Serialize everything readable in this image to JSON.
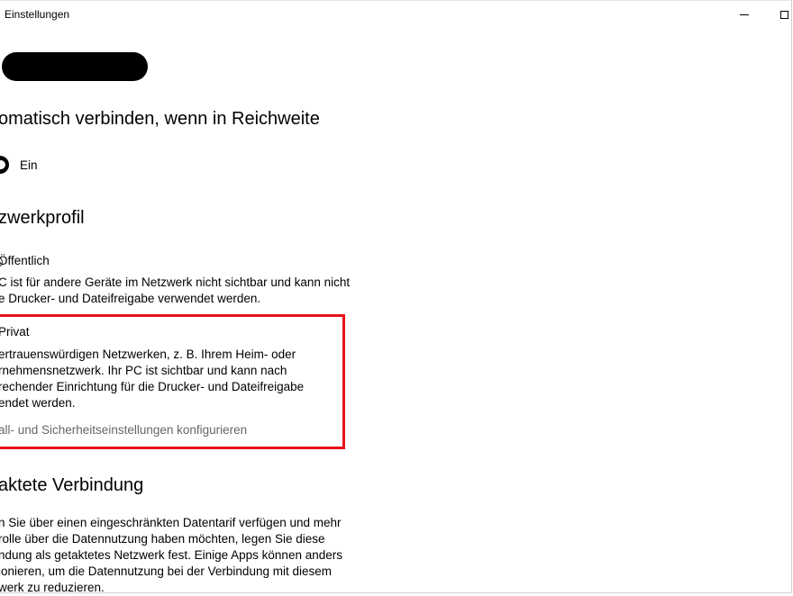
{
  "window": {
    "title": "Einstellungen"
  },
  "auto_connect": {
    "heading": "omatisch verbinden, wenn in Reichweite",
    "toggle_label": "Ein",
    "toggle_on": true
  },
  "network_profile": {
    "heading": "zwerkprofil",
    "public": {
      "label": "Öffentlich",
      "desc_line1": "C ist für andere Geräte im Netzwerk nicht sichtbar und kann nicht",
      "desc_line2": "e Drucker- und Dateifreigabe verwendet werden."
    },
    "private": {
      "label": "Privat",
      "desc_line1": "ertrauenswürdigen Netzwerken, z. B. Ihrem Heim- oder",
      "desc_line2": "rnehmensnetzwerk. Ihr PC ist sichtbar und kann nach",
      "desc_line3": "rechender Einrichtung für die Drucker- und Dateifreigabe",
      "desc_line4": "endet werden.",
      "link": "all- und Sicherheitseinstellungen konfigurieren"
    }
  },
  "metered": {
    "heading": "aktete Verbindung",
    "line1": "n Sie über einen eingeschränkten Datentarif verfügen und mehr",
    "line2": "rolle über die Datennutzung haben möchten, legen Sie diese",
    "line3": "ndung als getaktetes Netzwerk fest. Einige Apps können anders",
    "line4": "ionieren, um die Datennutzung bei der Verbindung mit diesem",
    "line5": "werk zu reduzieren."
  },
  "colors": {
    "highlight": "#e8141b",
    "link_grey": "#666666"
  }
}
